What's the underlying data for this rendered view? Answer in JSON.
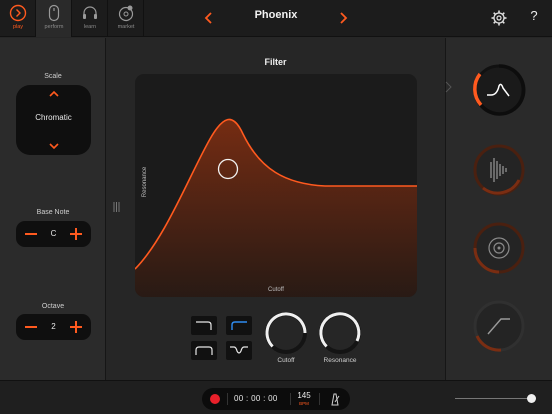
{
  "nav": {
    "tabs": [
      {
        "label": "play",
        "icon": "play-chevron-icon",
        "active": true
      },
      {
        "label": "perform",
        "icon": "perform-icon",
        "active": false
      },
      {
        "label": "learn",
        "icon": "headphones-icon",
        "active": false
      },
      {
        "label": "market",
        "icon": "market-icon",
        "active": false
      }
    ]
  },
  "header": {
    "preset_name": "Phoenix",
    "prev_icon": "chevron-left-icon",
    "next_icon": "chevron-right-icon",
    "settings_icon": "gear-icon",
    "help_label": "?"
  },
  "left": {
    "scale": {
      "title": "Scale",
      "value": "Chromatic"
    },
    "base_note": {
      "title": "Base Note",
      "value": "C"
    },
    "octave": {
      "title": "Octave",
      "value": "2"
    }
  },
  "filter": {
    "title": "Filter",
    "y_label": "Resonance",
    "x_label": "Cutoff",
    "types": [
      "low-pass",
      "high-pass",
      "band-pass",
      "notch"
    ],
    "selected_type": "high-pass",
    "knobs": [
      {
        "label": "Cutoff",
        "value": 0.75
      },
      {
        "label": "Resonance",
        "value": 0.68
      }
    ]
  },
  "modules": [
    {
      "name": "filter",
      "icon": "filter-curve-icon",
      "active": true
    },
    {
      "name": "waveform",
      "icon": "waveform-icon",
      "active": false
    },
    {
      "name": "target",
      "icon": "target-icon",
      "active": false
    },
    {
      "name": "envelope",
      "icon": "envelope-icon",
      "active": false
    }
  ],
  "transport": {
    "time": "00 : 00 : 00",
    "tempo": "145",
    "tempo_unit": "BPM",
    "record_icon": "record-icon",
    "metronome_icon": "metronome-icon"
  },
  "volume": {
    "level": 0.96
  },
  "colors": {
    "accent": "#ff5a1f",
    "blue_accent": "#2f8cf0",
    "background": "#262626"
  }
}
